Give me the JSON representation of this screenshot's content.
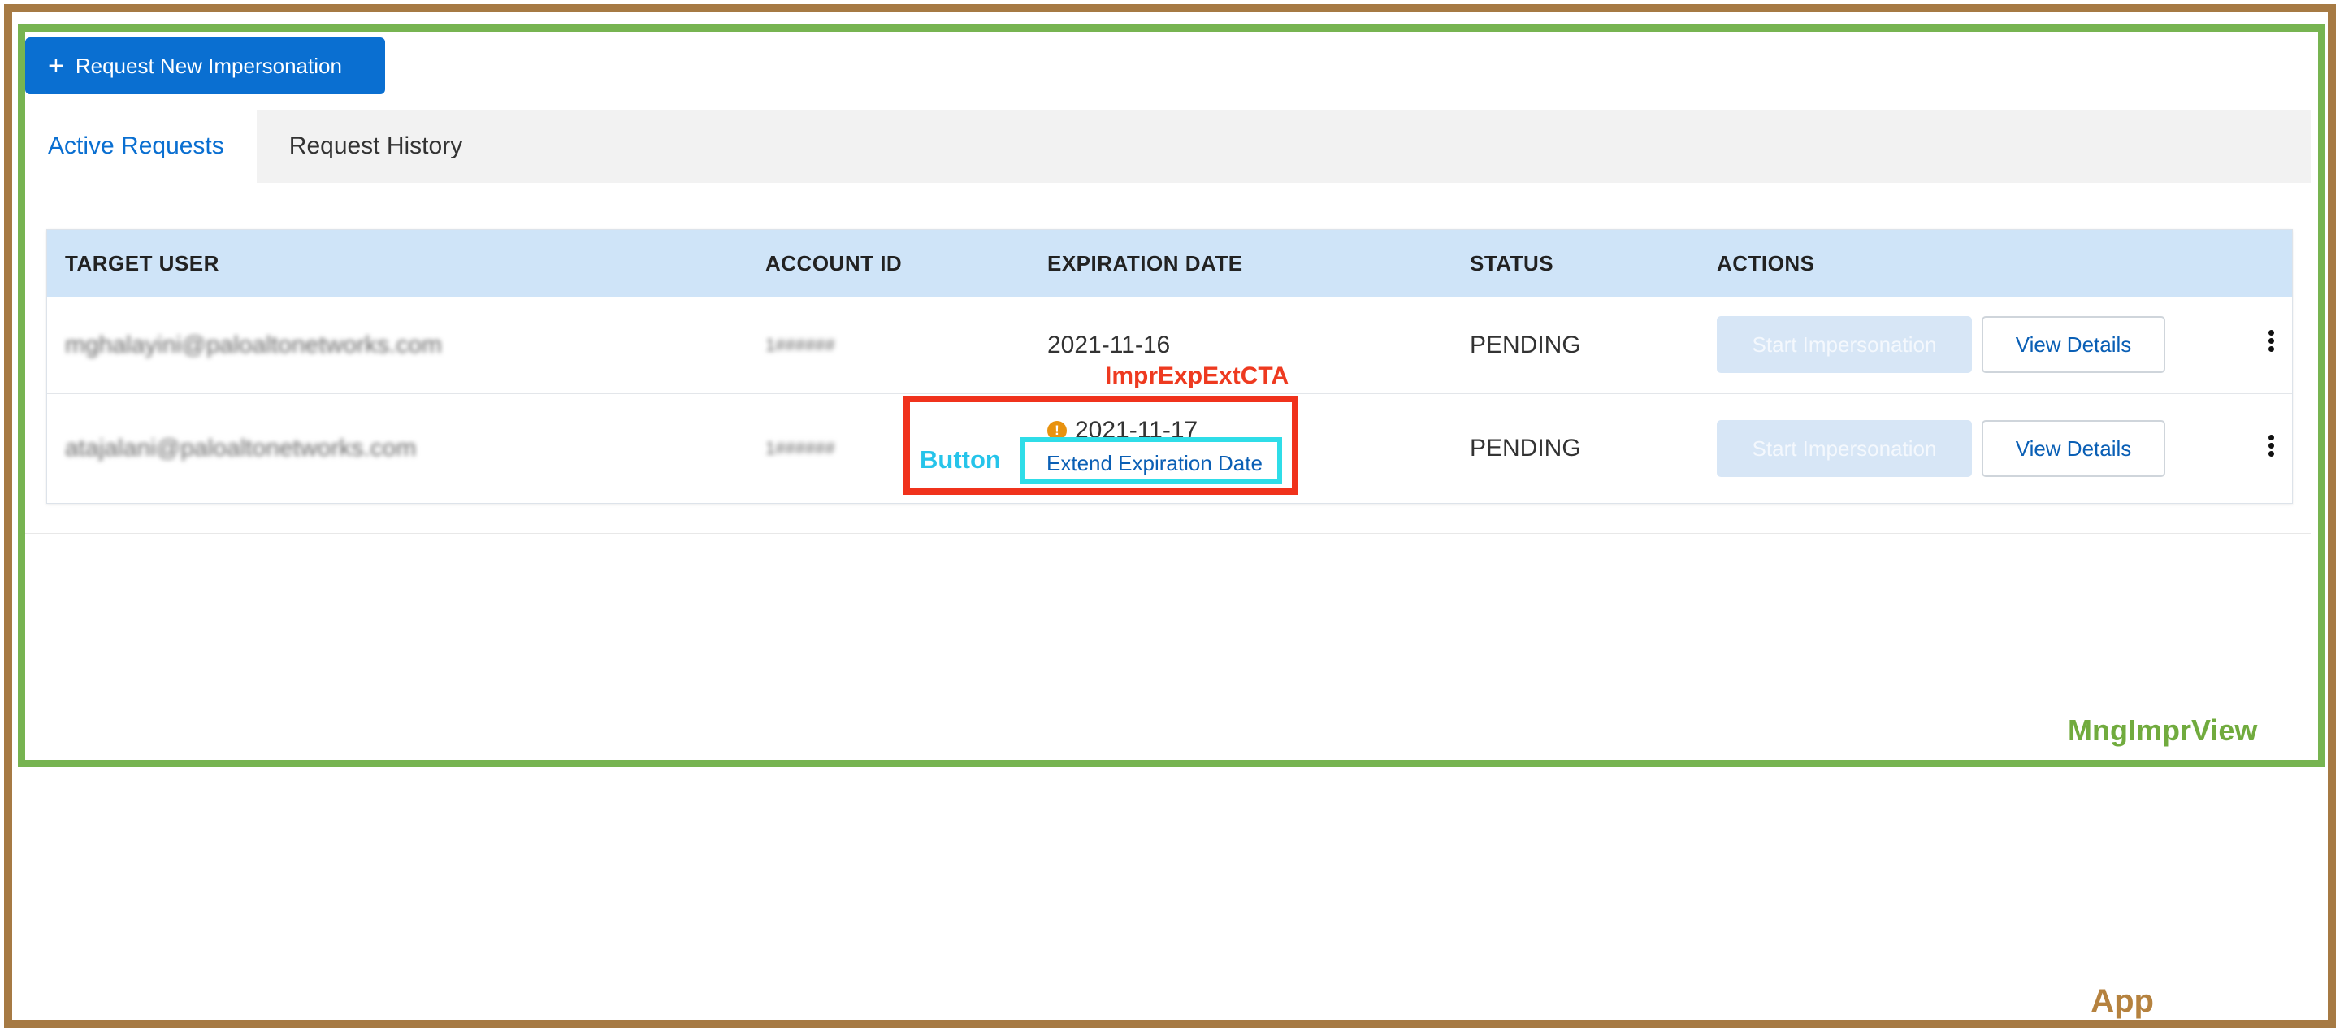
{
  "toolbar": {
    "request_new_label": "Request New Impersonation",
    "plus_glyph": "+"
  },
  "tabs": [
    {
      "label": "Active Requests",
      "active": true
    },
    {
      "label": "Request History",
      "active": false
    }
  ],
  "table": {
    "columns": [
      "TARGET USER",
      "ACCOUNT ID",
      "EXPIRATION DATE",
      "STATUS",
      "ACTIONS"
    ],
    "rows": [
      {
        "target_user": "mghalayini@paloaltonetworks.com",
        "account_id": "1######",
        "expiration_date": "2021-11-16",
        "status": "PENDING",
        "start_label": "Start Impersonation",
        "details_label": "View Details"
      },
      {
        "target_user": "atajalani@paloaltonetworks.com",
        "account_id": "1######",
        "expiration_date": "2021-11-17",
        "extend_label": "Extend Expiration Date",
        "status": "PENDING",
        "start_label": "Start Impersonation",
        "details_label": "View Details"
      }
    ]
  },
  "annotations": {
    "cta_label": "ImprExpExtCTA",
    "button_label": "Button",
    "view_label": "MngImprView",
    "app_label": "App"
  },
  "colors": {
    "primary": "#0a6fd1",
    "header_bg": "#cfe4f8",
    "app_frame": "#a67a44",
    "view_frame": "#77b451",
    "cta_frame": "#f0321c",
    "button_frame": "#2fdde8",
    "warning": "#e8920f"
  },
  "icons": {
    "warning_icon": "!",
    "kebab_icon": "kebab-menu"
  }
}
